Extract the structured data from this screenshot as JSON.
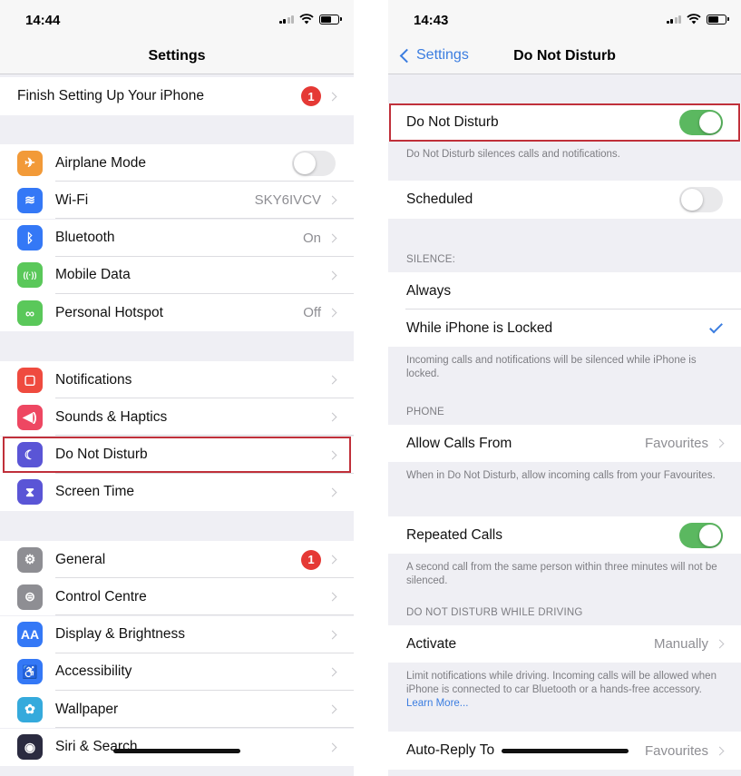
{
  "left": {
    "status": {
      "time": "14:44"
    },
    "title": "Settings",
    "finish": {
      "label": "Finish Setting Up Your iPhone",
      "badge": "1"
    },
    "group1": [
      {
        "label": "Airplane Mode",
        "icon": "airplane-icon",
        "color": "#f29a38",
        "glyph": "✈",
        "toggle": false
      },
      {
        "label": "Wi-Fi",
        "icon": "wifi-icon",
        "color": "#3478f6",
        "glyph": "≋",
        "value": "SKY6IVCV"
      },
      {
        "label": "Bluetooth",
        "icon": "bluetooth-icon",
        "color": "#3478f6",
        "glyph": "ᛒ",
        "value": "On"
      },
      {
        "label": "Mobile Data",
        "icon": "antenna-icon",
        "color": "#5ac85a",
        "glyph": "((·))",
        "value": ""
      },
      {
        "label": "Personal Hotspot",
        "icon": "link-icon",
        "color": "#5ac85a",
        "glyph": "∞",
        "value": "Off"
      }
    ],
    "group2": [
      {
        "label": "Notifications",
        "icon": "notifications-icon",
        "color": "#ef4b3f",
        "glyph": "▢"
      },
      {
        "label": "Sounds & Haptics",
        "icon": "speaker-icon",
        "color": "#ee4762",
        "glyph": "◀)"
      },
      {
        "label": "Do Not Disturb",
        "icon": "moon-icon",
        "color": "#5a55d6",
        "glyph": "☾"
      },
      {
        "label": "Screen Time",
        "icon": "hourglass-icon",
        "color": "#5a55d6",
        "glyph": "⧗"
      }
    ],
    "group3": [
      {
        "label": "General",
        "icon": "gear-icon",
        "color": "#8e8e93",
        "glyph": "⚙",
        "badge": "1"
      },
      {
        "label": "Control Centre",
        "icon": "switches-icon",
        "color": "#8e8e93",
        "glyph": "⊜"
      },
      {
        "label": "Display & Brightness",
        "icon": "text-size-icon",
        "color": "#3478f6",
        "glyph": "AA"
      },
      {
        "label": "Accessibility",
        "icon": "accessibility-icon",
        "color": "#3478f6",
        "glyph": "♿"
      },
      {
        "label": "Wallpaper",
        "icon": "flower-icon",
        "color": "#35aadc",
        "glyph": "✿"
      },
      {
        "label": "Siri & Search",
        "icon": "siri-icon",
        "color": "#2b2b40",
        "glyph": "◉"
      }
    ]
  },
  "right": {
    "status": {
      "time": "14:43"
    },
    "back": "Settings",
    "title": "Do Not Disturb",
    "dnd": {
      "label": "Do Not Disturb",
      "on": true
    },
    "dnd_footer": "Do Not Disturb silences calls and notifications.",
    "scheduled": {
      "label": "Scheduled",
      "on": false
    },
    "silence_header": "SILENCE:",
    "always": "Always",
    "while_locked": "While iPhone is Locked",
    "silence_footer": "Incoming calls and notifications will be silenced while iPhone is locked.",
    "phone_header": "PHONE",
    "allow_calls": {
      "label": "Allow Calls From",
      "value": "Favourites"
    },
    "allow_footer": "When in Do Not Disturb, allow incoming calls from your Favourites.",
    "repeated": {
      "label": "Repeated Calls",
      "on": true
    },
    "repeated_footer": "A second call from the same person within three minutes will not be silenced.",
    "driving_header": "DO NOT DISTURB WHILE DRIVING",
    "activate": {
      "label": "Activate",
      "value": "Manually"
    },
    "driving_footer": "Limit notifications while driving. Incoming calls will be allowed when iPhone is connected to car Bluetooth or a hands-free accessory.",
    "learn_more": "Learn More...",
    "auto_reply": {
      "label": "Auto-Reply To",
      "value": "Favourites"
    }
  },
  "colors": {
    "accent": "#3b7de0",
    "toggle_on": "#5bb860",
    "highlight": "#c0303a",
    "badge": "#e53935"
  }
}
